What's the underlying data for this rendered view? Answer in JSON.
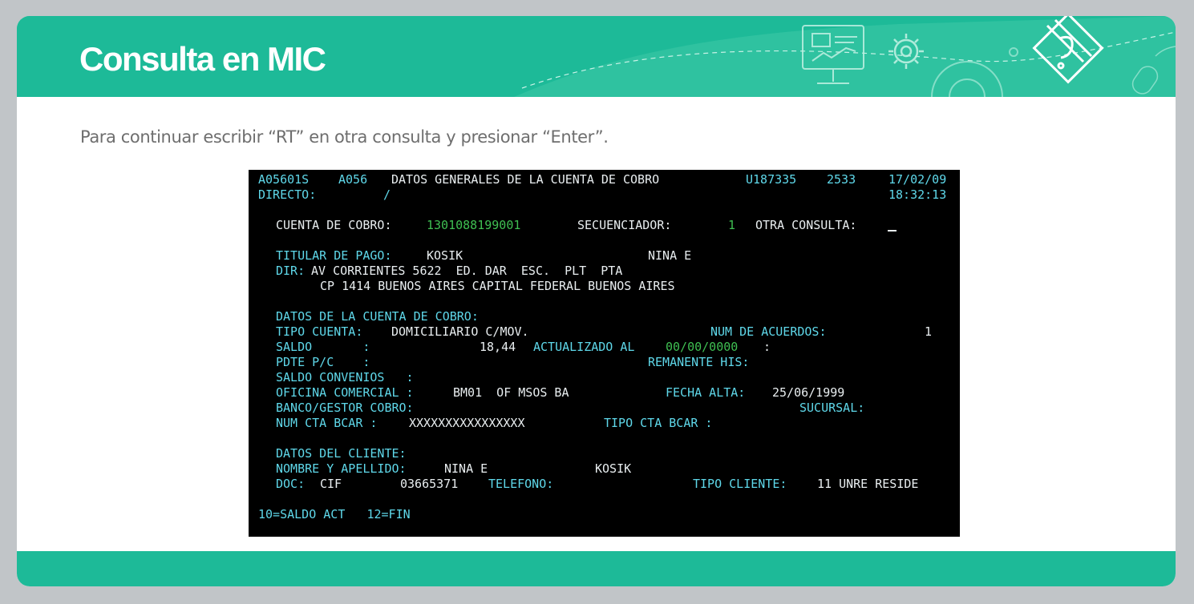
{
  "header": {
    "title": "Consulta en MIC",
    "accent_color": "#1dba98",
    "decor_icons": [
      "monitor-presentation-icon",
      "gear-icon",
      "pencil-diamond-icon",
      "mouse-icon"
    ]
  },
  "instruction": "Para continuar escribir “RT” en otra consulta y presionar “Enter”.",
  "terminal": {
    "program": "A05601S",
    "code": "A056",
    "screen_title": "DATOS GENERALES DE LA CUENTA DE COBRO",
    "user": "U187335",
    "terminal_id": "2533",
    "date": "17/02/09",
    "directo_label": "DIRECTO:",
    "directo_value": "/",
    "time": "18:32:13",
    "cuenta_label": "CUENTA DE COBRO:",
    "cuenta_value": "1301088199001",
    "secuenciador_label": "SECUENCIADOR:",
    "secuenciador_value": "1",
    "otra_consulta_label": "OTRA CONSULTA:",
    "titular_label": "TITULAR DE PAGO:",
    "titular_apellido": "KOSIK",
    "titular_nombre": "NINA E",
    "dir_label": "DIR:",
    "dir_line1": "AV CORRIENTES 5622  ED. DAR  ESC.  PLT  PTA",
    "dir_line2": "CP 1414 BUENOS AIRES CAPITAL FEDERAL BUENOS AIRES",
    "datos_cuenta_label": "DATOS DE LA CUENTA DE COBRO:",
    "tipo_cuenta_label": "TIPO CUENTA:",
    "tipo_cuenta_value": "DOMICILIARIO C/MOV.",
    "num_acuerdos_label": "NUM DE ACUERDOS:",
    "num_acuerdos_value": "1",
    "saldo_label": "SALDO       :",
    "saldo_value": "18,44",
    "actualizado_label": "ACTUALIZADO AL",
    "actualizado_value": "00/00/0000",
    "actualizado_colon": ":",
    "pdte_label": "PDTE P/C    :",
    "remanente_label": "REMANENTE HIS:",
    "saldo_convenios_label": "SALDO CONVENIOS   :",
    "oficina_label": "OFICINA COMERCIAL :",
    "oficina_value": "BM01  OF MSOS BA",
    "fecha_alta_label": "FECHA ALTA:",
    "fecha_alta_value": "25/06/1999",
    "banco_label": "BANCO/GESTOR COBRO:",
    "sucursal_label": "SUCURSAL:",
    "num_cta_label": "NUM CTA BCAR :",
    "num_cta_value": "XXXXXXXXXXXXXXXX",
    "tipo_cta_label": "TIPO CTA BCAR :",
    "datos_cliente_label": "DATOS DEL CLIENTE:",
    "nombre_label": "NOMBRE Y APELLIDO:",
    "nombre_value": "NINA E",
    "apellido_value": "KOSIK",
    "doc_label": "DOC:",
    "doc_type": "CIF",
    "doc_number": "03665371",
    "telefono_label": "TELEFONO:",
    "tipo_cliente_label": "TIPO CLIENTE:",
    "tipo_cliente_value": "11 UNRE RESIDE",
    "fkeys": "10=SALDO ACT   12=FIN"
  }
}
